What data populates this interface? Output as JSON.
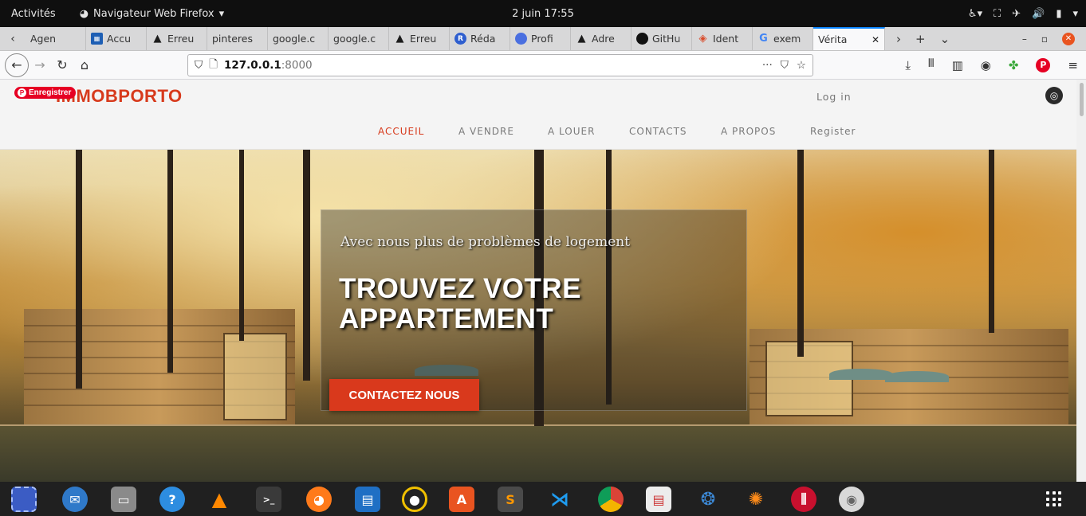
{
  "system": {
    "activities": "Activités",
    "app_name": "Navigateur Web Firefox",
    "app_caret": "▾",
    "clock": "2 juin  17:55"
  },
  "tabs": [
    {
      "label": "Agen",
      "icon": "arrow-icon"
    },
    {
      "label": "Accu",
      "icon": "site-icon"
    },
    {
      "label": "Erreu",
      "icon": "warning-icon"
    },
    {
      "label": "pinteres",
      "icon": "none"
    },
    {
      "label": "google.c",
      "icon": "none"
    },
    {
      "label": "google.c",
      "icon": "none"
    },
    {
      "label": "Erreu",
      "icon": "warning-icon"
    },
    {
      "label": "Réda",
      "icon": "reda-icon"
    },
    {
      "label": "Profi",
      "icon": "profile-icon"
    },
    {
      "label": "Adre",
      "icon": "warning-icon"
    },
    {
      "label": "GitHu",
      "icon": "github-icon"
    },
    {
      "label": "Ident",
      "icon": "identity-icon"
    },
    {
      "label": "exem",
      "icon": "google-icon"
    },
    {
      "label": "Vérita",
      "icon": "none",
      "active": true
    }
  ],
  "url": {
    "host": "127.0.0.1",
    "port": ":8000"
  },
  "site": {
    "pin_label": "Enregistrer",
    "brand": "IMMOBPORTO",
    "login": "Log in",
    "menu": [
      {
        "label": "ACCUEIL",
        "active": true
      },
      {
        "label": "A VENDRE"
      },
      {
        "label": "A LOUER"
      },
      {
        "label": "CONTACTS"
      },
      {
        "label": "A PROPOS"
      },
      {
        "label": "Register"
      }
    ]
  },
  "hero": {
    "subtitle": "Avec nous plus de problèmes de logement",
    "headline_line1": "TROUVEZ VOTRE",
    "headline_line2": "APPARTEMENT",
    "cta": "CONTACTEZ NOUS"
  },
  "colors": {
    "accent": "#d73a1c",
    "cta": "#d9391c",
    "firefox_blue": "#0a84ff"
  }
}
